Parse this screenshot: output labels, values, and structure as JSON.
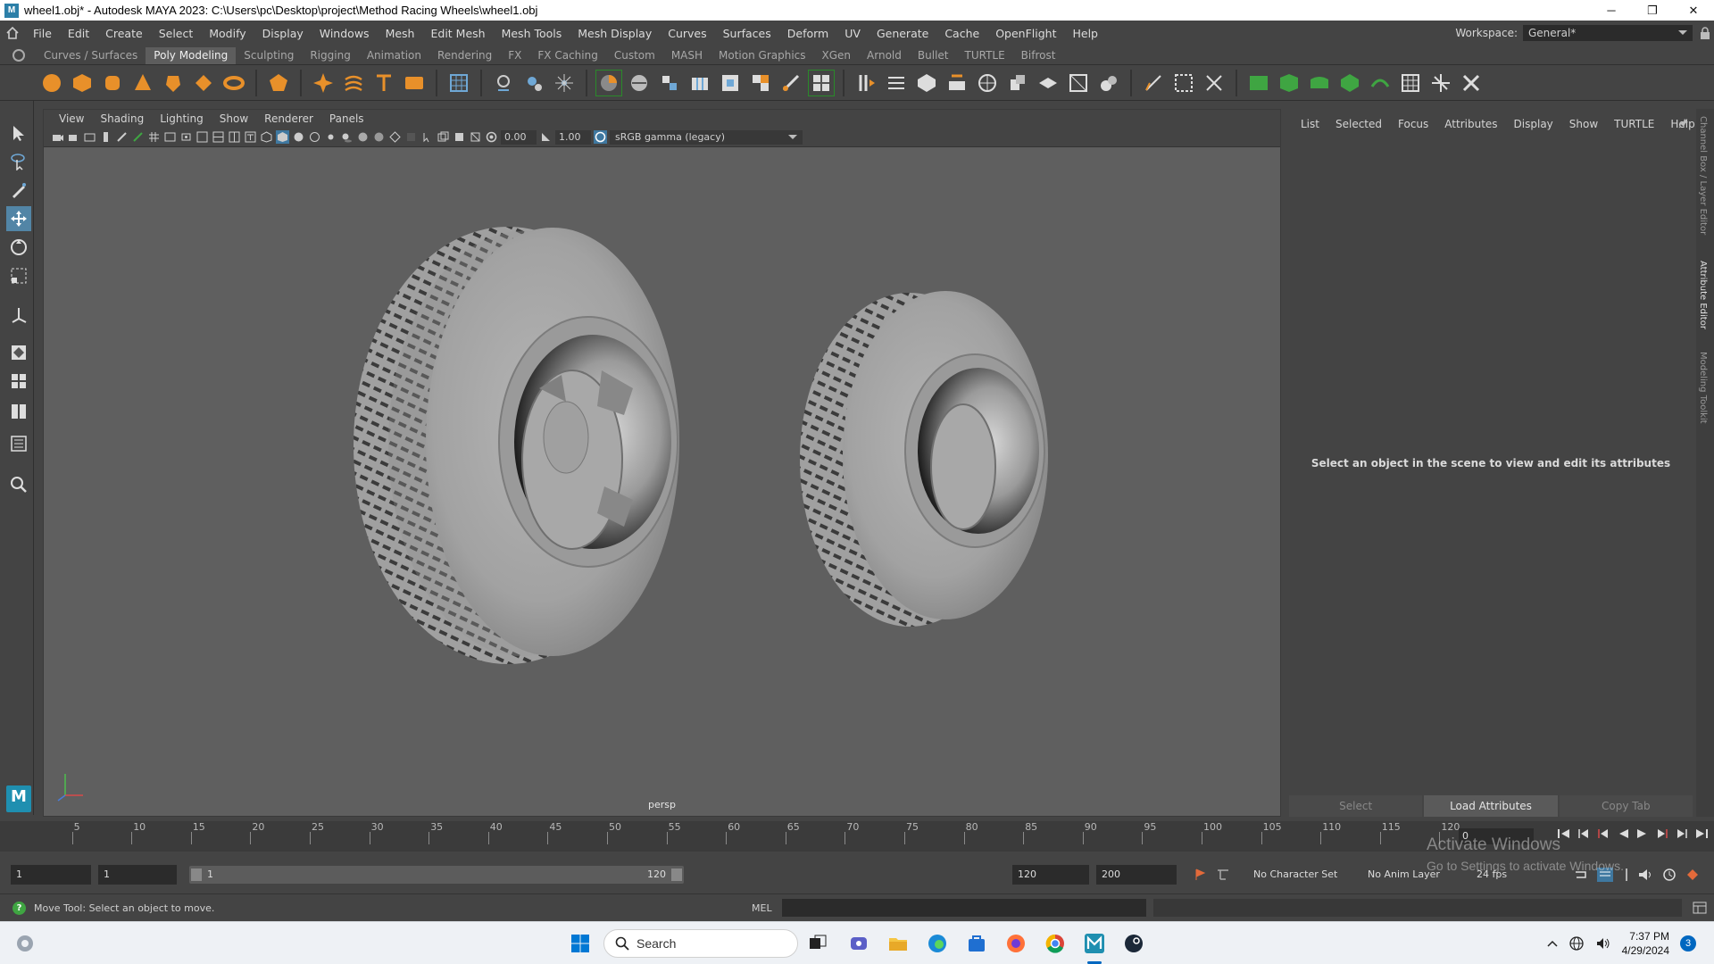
{
  "window": {
    "title": "wheel1.obj* - Autodesk MAYA 2023: C:\\Users\\pc\\Desktop\\project\\Method Racing Wheels\\wheel1.obj",
    "app_icon_letter": "M",
    "minimize": "─",
    "maximize": "❐",
    "close": "✕"
  },
  "menubar": {
    "items": [
      "File",
      "Edit",
      "Create",
      "Select",
      "Modify",
      "Display",
      "Windows",
      "Mesh",
      "Edit Mesh",
      "Mesh Tools",
      "Mesh Display",
      "Curves",
      "Surfaces",
      "Deform",
      "UV",
      "Generate",
      "Cache",
      "OpenFlight",
      "Help"
    ],
    "workspace_label": "Workspace:",
    "workspace_value": "General*"
  },
  "shelf_tabs": {
    "items": [
      "Curves / Surfaces",
      "Poly Modeling",
      "Sculpting",
      "Rigging",
      "Animation",
      "Rendering",
      "FX",
      "FX Caching",
      "Custom",
      "MASH",
      "Motion Graphics",
      "XGen",
      "Arnold",
      "Bullet",
      "TURTLE",
      "Bifrost"
    ],
    "active": "Poly Modeling"
  },
  "viewport": {
    "menu": [
      "View",
      "Shading",
      "Lighting",
      "Show",
      "Renderer",
      "Panels"
    ],
    "exposure": "0.00",
    "gamma": "1.00",
    "color_space": "sRGB gamma (legacy)",
    "camera": "persp"
  },
  "attribute_editor": {
    "menu": [
      "List",
      "Selected",
      "Focus",
      "Attributes",
      "Display",
      "Show",
      "TURTLE",
      "Help"
    ],
    "message": "Select an object in the scene to view and edit its attributes",
    "buttons": [
      "Select",
      "Load Attributes",
      "Copy Tab"
    ]
  },
  "side_tabs": [
    "Channel Box / Layer Editor",
    "Attribute Editor",
    "Modeling Toolkit"
  ],
  "timeline": {
    "ticks": [
      "5",
      "10",
      "15",
      "20",
      "25",
      "30",
      "35",
      "40",
      "45",
      "50",
      "55",
      "60",
      "65",
      "70",
      "75",
      "80",
      "85",
      "90",
      "95",
      "100",
      "105",
      "110",
      "115",
      "120"
    ],
    "current_frame": "0"
  },
  "range": {
    "start": "1",
    "playback_start": "1",
    "slider_start": "1",
    "slider_end": "120",
    "playback_end": "120",
    "end": "200",
    "character_set": "No Character Set",
    "anim_layer": "No Anim Layer",
    "fps": "24 fps"
  },
  "watermark": {
    "line1": "Activate Windows",
    "line2": "Go to Settings to activate Windows."
  },
  "statusline": {
    "help_text": "Move Tool: Select an object to move.",
    "mel_label": "MEL"
  },
  "taskbar": {
    "search_placeholder": "Search",
    "time": "7:37 PM",
    "date": "4/29/2024",
    "notifications": "3"
  },
  "colors": {
    "maya_blue": "#1f8fb0",
    "viewport_bg": "#5f5f5f",
    "active_tool": "#5285a6",
    "accent_green": "#2a8a2a",
    "shelf_orange": "#e8902a"
  }
}
